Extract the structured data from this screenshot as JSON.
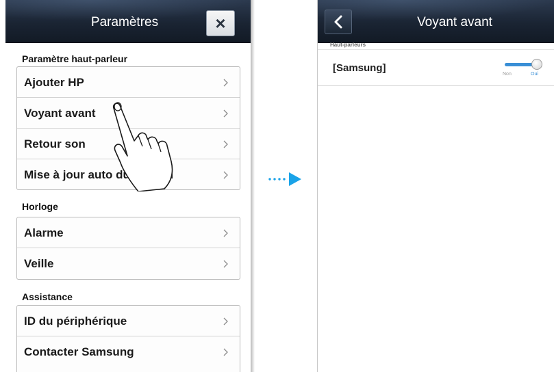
{
  "left_screen": {
    "title": "Paramètres",
    "close_symbol": "×",
    "sections": [
      {
        "header": "Paramètre haut-parleur",
        "items": [
          {
            "label": "Ajouter HP"
          },
          {
            "label": "Voyant avant"
          },
          {
            "label": "Retour son"
          },
          {
            "label": "Mise à jour auto du logiciel"
          }
        ]
      },
      {
        "header": "Horloge",
        "items": [
          {
            "label": "Alarme"
          },
          {
            "label": "Veille"
          }
        ]
      },
      {
        "header": "Assistance",
        "items": [
          {
            "label": "ID du périphérique"
          },
          {
            "label": "Contacter Samsung"
          }
        ]
      }
    ]
  },
  "right_screen": {
    "title": "Voyant avant",
    "back_icon": "chevron-left-icon",
    "section_label": "Haut-parleurs",
    "setting": {
      "label": "[Samsung]",
      "toggle_off_label": "Non",
      "toggle_on_label": "Oui",
      "toggle_state": "on"
    }
  },
  "colors": {
    "titlebar": "#1a2433",
    "toggle_on": "#3a8fd6",
    "arrow": "#1aa3e8"
  }
}
